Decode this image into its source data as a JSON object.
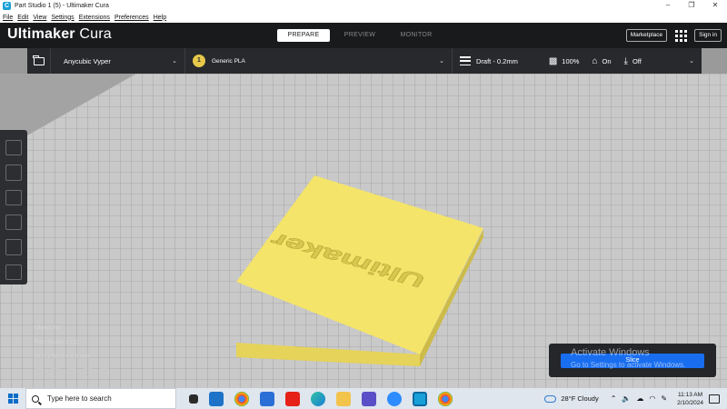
{
  "window": {
    "title": "Part Studio 1 (5) - Ultimaker Cura",
    "app_icon": "C",
    "min": "–",
    "max": "❐",
    "close": "✕"
  },
  "menu": [
    "File",
    "Edit",
    "View",
    "Settings",
    "Extensions",
    "Preferences",
    "Help"
  ],
  "header": {
    "brand_bold": "Ultimaker",
    "brand_light": " Cura",
    "tabs": [
      {
        "label": "PREPARE",
        "active": true
      },
      {
        "label": "PREVIEW",
        "active": false
      },
      {
        "label": "MONITOR",
        "active": false
      }
    ],
    "marketplace": "Marketplace",
    "sign_in": "Sign in"
  },
  "toolbar": {
    "printer": "Anycubic Vyper",
    "extruder_number": "1",
    "material": "Generic PLA",
    "profile": "Draft - 0.2mm",
    "infill": "100%",
    "support": "On",
    "adhesion": "Off"
  },
  "model": {
    "text": "Ultimaker",
    "color": "#f4e46a"
  },
  "object_info": {
    "list_label": "Object list",
    "object_name": "Part Studio 1 (5)",
    "dimensions": "61.0 x 50.8 x 8.5 mm"
  },
  "slice": {
    "button": "Slice"
  },
  "watermark": {
    "line1": "Activate Windows",
    "line2": "Go to Settings to activate Windows."
  },
  "taskbar": {
    "search_placeholder": "Type here to search",
    "weather": "28°F  Cloudy",
    "time": "11:13 AM",
    "date": "2/10/2024"
  },
  "colors": {
    "accent": "#196ef0",
    "header": "#191a1c",
    "toolbar": "#27292c",
    "plate": "#f4e46a"
  }
}
